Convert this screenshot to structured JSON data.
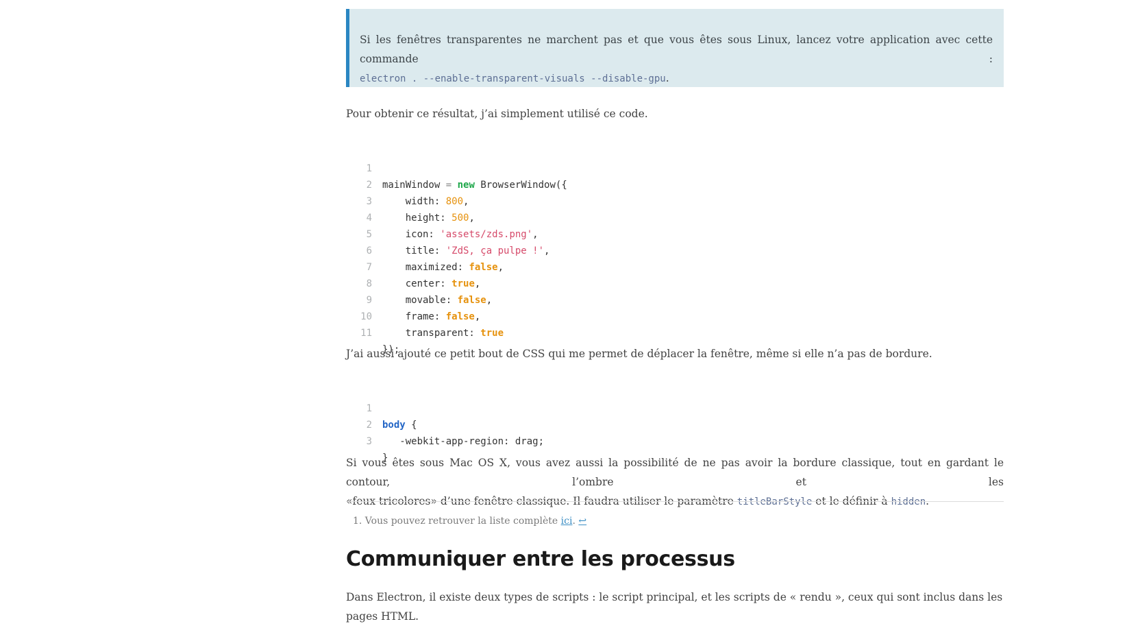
{
  "note": {
    "text": "Si les fenêtres transparentes ne marchent pas et que vous êtes sous Linux, lancez votre application avec cette commande :",
    "command": "electron . --enable-transparent-visuals --disable-gpu",
    "trailing": "."
  },
  "para1": "Pour obtenir ce résultat, j’ai simplement utilisé ce code.",
  "code_js": {
    "line_numbers": [
      "1",
      "2",
      "3",
      "4",
      "5",
      "6",
      "7",
      "8",
      "9",
      "10",
      "11"
    ],
    "lines": [
      {
        "t1": "mainWindow",
        "op": " = ",
        "kw": "new",
        "t2": " BrowserWindow({"
      },
      {
        "key": "    width: ",
        "val": "800",
        "end": ","
      },
      {
        "key": "    height: ",
        "val": "500",
        "end": ","
      },
      {
        "key": "    icon: ",
        "val": "'assets/zds.png'",
        "end": ","
      },
      {
        "key": "    title: ",
        "val": "'ZdS, ça pulpe !'",
        "end": ","
      },
      {
        "key": "    maximized: ",
        "val": "false",
        "end": ","
      },
      {
        "key": "    center: ",
        "val": "true",
        "end": ","
      },
      {
        "key": "    movable: ",
        "val": "false",
        "end": ","
      },
      {
        "key": "    frame: ",
        "val": "false",
        "end": ","
      },
      {
        "key": "    transparent: ",
        "val": "true",
        "end": ""
      },
      {
        "text": "});"
      }
    ]
  },
  "para2": "J’ai aussi ajouté ce petit bout de CSS qui me permet de déplacer la fenêtre, même si elle n’a pas de bordure.",
  "code_css": {
    "line_numbers": [
      "1",
      "2",
      "3"
    ],
    "selector": "body",
    "open": " {",
    "rule": "   -webkit-app-region: drag;",
    "close": "}"
  },
  "para3": {
    "line1": "Si vous êtes sous Mac OS X, vous avez aussi la possibilité de ne pas avoir la bordure classique, tout en gardant le contour, l’ombre et les",
    "line2_pre": "«feux tricolores» d’une fenêtre classique. Il faudra utiliser le paramètre ",
    "code1": "titleBarStyle",
    "line2_mid": " et le définir à ",
    "code2": "hidden",
    "line2_end": "."
  },
  "footnote": {
    "number": "1.",
    "text": " Vous pouvez retrouver la liste complète ",
    "link": "ici",
    "after": ". ",
    "backref": "↩"
  },
  "heading": "Communiquer entre les processus",
  "para4": "Dans Electron, il existe deux types de scripts : le script principal, et les scripts de « rendu », ceux qui sont inclus dans les pages HTML."
}
